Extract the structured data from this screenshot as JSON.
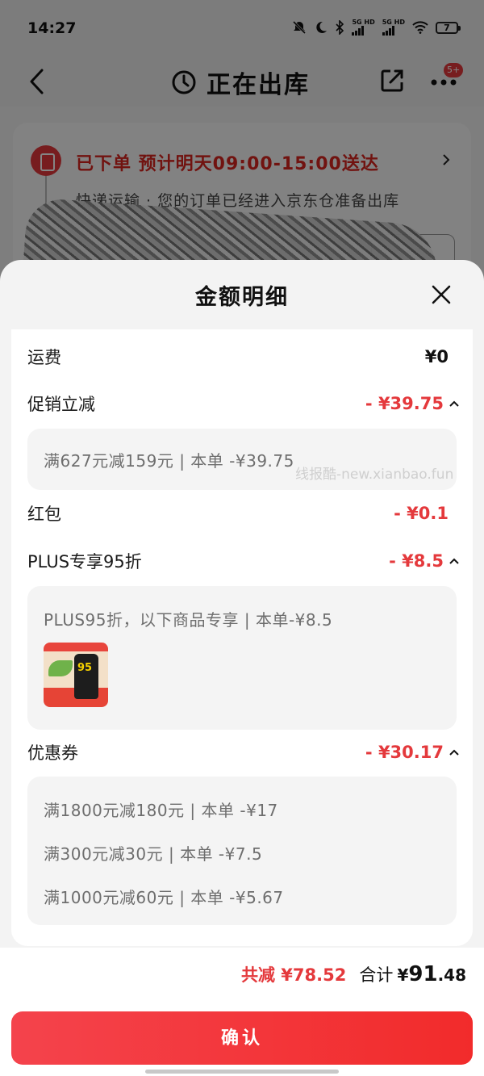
{
  "status_bar": {
    "time": "14:27",
    "network_1": "5G HD",
    "network_2": "5G HD",
    "battery": "7"
  },
  "nav": {
    "title": "正在出库",
    "more_badge": "5+"
  },
  "order_card": {
    "status": "已下单  预计明天09:00-15:00送达",
    "description": "快递运输 · 您的订单已经进入京东仓准备出库"
  },
  "sheet": {
    "title": "金额明细",
    "rows": {
      "shipping": {
        "label": "运费",
        "amount": "¥0"
      },
      "promo": {
        "label": "促销立减",
        "amount": "- ¥39.75",
        "details": [
          "满627元减159元 | 本单 -¥39.75"
        ]
      },
      "red_packet": {
        "label": "红包",
        "amount": "- ¥0.1"
      },
      "plus": {
        "label": "PLUS专享95折",
        "amount": "- ¥8.5",
        "details": [
          "PLUS95折，以下商品专享 | 本单-¥8.5"
        ]
      },
      "coupon": {
        "label": "优惠券",
        "amount": "- ¥30.17",
        "details": [
          "满1800元减180元 | 本单 -¥17",
          "满300元减30元 | 本单 -¥7.5",
          "满1000元减60元 | 本单 -¥5.67"
        ]
      }
    },
    "watermark": "线报酷-new.xianbao.fun"
  },
  "footer": {
    "total_saved": "共减 ¥78.52",
    "total_label": "合计",
    "total_currency": "¥",
    "total_int": "91",
    "total_dec": ".48",
    "confirm": "确认"
  },
  "colors": {
    "accent_red": "#e4393c",
    "confirm_button": "#f4434c"
  }
}
